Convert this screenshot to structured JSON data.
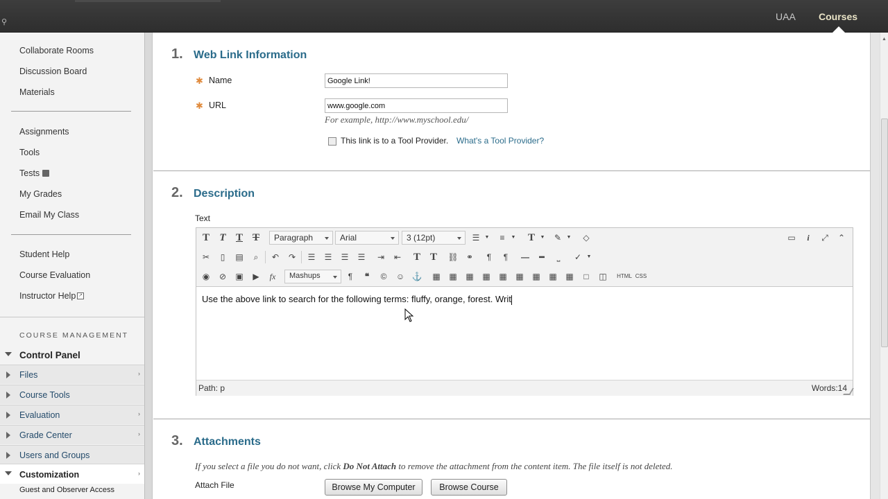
{
  "topbar": {
    "tab_uaa": "UAA",
    "tab_courses": "Courses"
  },
  "sidebar": {
    "course_links": [
      "Collaborate Rooms",
      "Discussion Board",
      "Materials"
    ],
    "links_group2": [
      "Assignments",
      "Tools",
      "Tests",
      "My Grades",
      "Email My Class"
    ],
    "links_group3": [
      "Student Help",
      "Course Evaluation",
      "Instructor Help"
    ],
    "course_management": "COURSE MANAGEMENT",
    "control_panel": "Control Panel",
    "cp_items": [
      "Files",
      "Course Tools",
      "Evaluation",
      "Grade Center",
      "Users and Groups"
    ],
    "customization": "Customization",
    "sub_item": "Guest and Observer Access"
  },
  "section1": {
    "number": "1.",
    "title": "Web Link Information",
    "name_label": "Name",
    "name_value": "Google Link!",
    "url_label": "URL",
    "url_value": "www.google.com",
    "url_hint": "For example, http://www.myschool.edu/",
    "tool_provider_label": "This link is to a Tool Provider.",
    "tool_provider_link": "What's a Tool Provider?"
  },
  "section2": {
    "number": "2.",
    "title": "Description",
    "text_label": "Text",
    "format_select": "Paragraph",
    "font_select": "Arial",
    "size_select": "3 (12pt)",
    "mashups": "Mashups",
    "html_btn": "HTML",
    "css_btn": "CSS",
    "editor_text": "Use the above link to search for the following terms: fluffy, orange, forest. Writ",
    "path": "Path: p",
    "words": "Words:14"
  },
  "section3": {
    "number": "3.",
    "title": "Attachments",
    "instructions_pre": "If you select a file you do not want, click ",
    "instructions_bold": "Do Not Attach",
    "instructions_post": " to remove the attachment from the content item. The file itself is not deleted.",
    "attach_label": "Attach File",
    "browse_computer": "Browse My Computer",
    "browse_course": "Browse Course"
  }
}
